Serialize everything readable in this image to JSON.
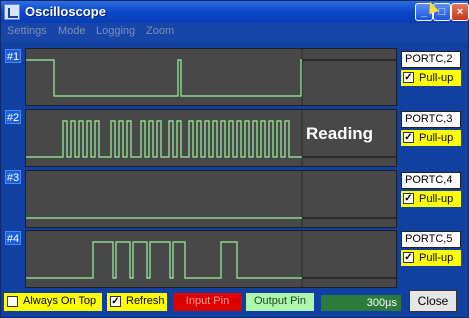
{
  "window": {
    "title": "Oscilloscope"
  },
  "menu": [
    "Settings",
    "Mode",
    "Logging",
    "Zoom"
  ],
  "channels": [
    {
      "label": "#1",
      "port": "PORTC,2",
      "pullup_label": "Pull-up",
      "pullup_checked": true,
      "overlay": ""
    },
    {
      "label": "#2",
      "port": "PORTC,3",
      "pullup_label": "Pull-up",
      "pullup_checked": true,
      "overlay": "Reading"
    },
    {
      "label": "#3",
      "port": "PORTC,4",
      "pullup_label": "Pull-up",
      "pullup_checked": true,
      "overlay": ""
    },
    {
      "label": "#4",
      "port": "PORTC,5",
      "pullup_label": "Pull-up",
      "pullup_checked": true,
      "overlay": ""
    }
  ],
  "bottom": {
    "always_on_top_label": "Always On Top",
    "always_on_top_checked": false,
    "refresh_label": "Refresh",
    "refresh_checked": true,
    "input_pin_label": "Input Pin",
    "output_pin_label": "Output Pin",
    "timebase": "300µs",
    "close_label": "Close"
  },
  "colors": {
    "trace": "#9cf29c",
    "scope_bg": "#484848",
    "input_pin": "#dd0000",
    "output_pin": "#aef5ae",
    "pullup_bg": "#ffff00"
  }
}
